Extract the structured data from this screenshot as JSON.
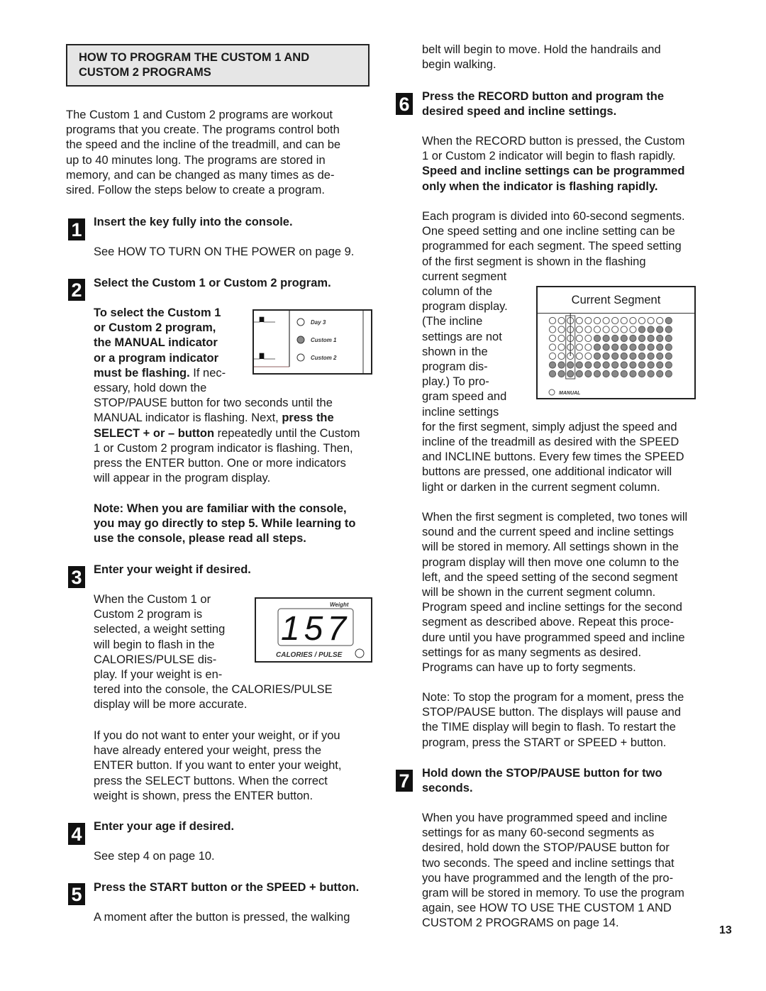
{
  "page_number": "13",
  "heading": {
    "line1": "HOW TO PROGRAM THE CUSTOM 1 AND",
    "line2": "CUSTOM  2 PROGRAMS"
  },
  "intro": [
    "The Custom 1 and Custom 2 programs are workout",
    "programs that you create. The programs control both",
    "the speed and the incline of the treadmill, and can be",
    "up to 40 minutes long. The programs are stored in",
    "memory, and can be changed as many times as de-",
    "sired. Follow the steps below to create a program."
  ],
  "steps": {
    "s1": {
      "number": "1",
      "title": "Insert the key fully into the console.",
      "body": "See HOW TO TURN ON THE POWER on page 9."
    },
    "s2": {
      "number": "2",
      "title": "Select the Custom 1 or Custom 2 program.",
      "bold_lines": [
        "To select the Custom 1",
        "or Custom 2 program,",
        "the MANUAL indicator",
        "or a program indicator"
      ],
      "line5_bold": "must be flashing.",
      "line5_rest": " If nec-",
      "line6": "essary, hold down the",
      "line7": "STOP/PAUSE button for two seconds until the",
      "line8_a": "MANUAL indicator is flashing. Next, ",
      "line8_b": "press the",
      "line9_a": "SELECT + or – button",
      "line9_b": " repeatedly until the Custom",
      "line10": "1 or Custom 2 program indicator is flashing. Then,",
      "line11": "press the ENTER button. One or more indicators",
      "line12": "will appear in the program display.",
      "note": [
        "Note: When you are familiar with the console,",
        "you may go directly to step 5. While learning to",
        "use the console, please read all steps."
      ]
    },
    "s3": {
      "number": "3",
      "title": "Enter your weight if desired.",
      "wrap_lines": [
        "When the Custom 1 or",
        "Custom 2 program is",
        "selected, a weight setting",
        "will begin to flash in the",
        "CALORIES/PULSE dis-",
        "play. If your weight is en-"
      ],
      "full_lines": [
        "tered into the console, the CALORIES/PULSE",
        "display will be more accurate."
      ],
      "para2": [
        "If you do not want to enter your weight, or if you",
        "have already entered your weight, press the",
        "ENTER button. If you want to enter your weight,",
        "press the SELECT buttons. When the correct",
        "weight is shown, press the ENTER button."
      ]
    },
    "s4": {
      "number": "4",
      "title": "Enter your age if desired.",
      "body": "See step 4 on page 10."
    },
    "s5": {
      "number": "5",
      "title": "Press the START button or the SPEED + button.",
      "body_col1": "A moment after the button is pressed, the walking",
      "body_col2": [
        "belt will begin to move. Hold the handrails and",
        "begin walking."
      ]
    },
    "s6": {
      "number": "6",
      "title": [
        "Press the RECORD button and program the",
        "desired speed and incline settings."
      ],
      "para1": [
        "When the RECORD button is pressed, the Custom",
        "1 or Custom 2 indicator will begin to flash rapidly."
      ],
      "para1_bold": [
        "Speed and incline settings can be programmed",
        "only when the indicator is flashing rapidly."
      ],
      "para2_full": [
        "Each program is divided into 60-second segments.",
        "One speed setting and one incline setting can be",
        "programmed for each segment. The speed setting",
        "of the first segment is shown in the flashing"
      ],
      "para2_wrap": [
        "current segment",
        "column of the",
        "program display.",
        "(The incline",
        "settings are not",
        "shown in the",
        "program dis-",
        "play.) To pro-",
        "gram speed and",
        "incline settings"
      ],
      "para2_rest": [
        "for the first segment, simply adjust the speed and",
        "incline of the treadmill as desired with the SPEED",
        "and INCLINE buttons. Every few times the SPEED",
        "buttons are pressed, one additional indicator will",
        "light or darken in the current segment column."
      ],
      "para3": [
        "When the first segment is completed, two tones will",
        "sound and the current speed and incline settings",
        "will be stored in memory. All settings shown in the",
        "program display will then move one column to the",
        "left, and the speed setting of the second segment",
        "will be shown in the current segment column.",
        "Program speed and incline settings for the second",
        "segment as described above. Repeat this proce-",
        "dure until you have programmed speed and incline",
        "settings for as many segments as desired.",
        "Programs can have up to forty segments."
      ],
      "note": [
        "Note: To stop the program for a moment, press the",
        "STOP/PAUSE button. The displays will pause and",
        "the TIME display will begin to flash. To restart the",
        "program, press the START or SPEED + button."
      ]
    },
    "s7": {
      "number": "7",
      "title": [
        "Hold down the STOP/PAUSE button for two",
        "seconds."
      ],
      "body": [
        "When you have programmed speed and incline",
        "settings for as many 60-second segments as",
        "desired, hold down the STOP/PAUSE button for",
        "two seconds. The speed and incline settings that",
        "you have programmed and the length of the pro-",
        "gram will be stored in memory. To use the program",
        "again, see HOW TO USE THE CUSTOM 1 AND",
        "CUSTOM 2 PROGRAMS on page 14."
      ]
    }
  },
  "figures": {
    "program_indicators": {
      "labels": [
        "Day 3",
        "Custom 1",
        "Custom 2"
      ],
      "lit": [
        false,
        true,
        false
      ]
    },
    "weight_display": {
      "label_top": "Weight",
      "value": "157",
      "label_bottom": "CALORIES / PULSE"
    },
    "program_display": {
      "title": "Current Segment",
      "columns": 14,
      "rows": 7,
      "current_segment_column": 3,
      "filled_from_column_per_row": [
        14,
        11,
        6,
        6,
        6,
        1,
        1
      ],
      "manual_label": "MANUAL",
      "fill_color": "#8a8a8a"
    }
  }
}
